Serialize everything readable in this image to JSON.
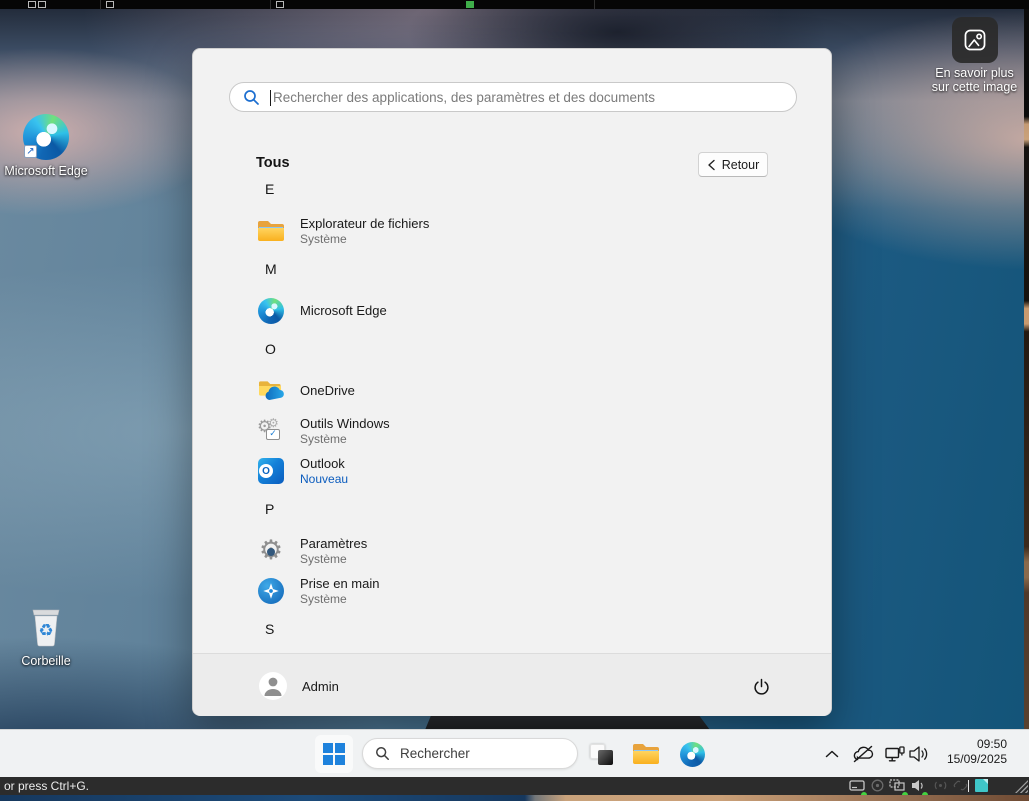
{
  "colors": {
    "accent": "#0067c0",
    "nouveau_link": "#0b5cbe",
    "menu_bg": "#f2f2f2",
    "taskbar_bg": "#f0f2f3"
  },
  "desktop": {
    "icons": [
      {
        "label": "Microsoft Edge"
      },
      {
        "label": "Corbeille"
      }
    ],
    "spotlight": {
      "line1": "En savoir plus",
      "line2": "sur cette image"
    }
  },
  "start_menu": {
    "search_placeholder": "Rechercher des applications, des paramètres et des documents",
    "section_title": "Tous",
    "back_button": "Retour",
    "letters": [
      "E",
      "M",
      "O",
      "P",
      "S"
    ],
    "apps": [
      {
        "name": "Explorateur de fichiers",
        "sub": "Système"
      },
      {
        "name": "Microsoft Edge"
      },
      {
        "name": "OneDrive"
      },
      {
        "name": "Outils Windows",
        "sub": "Système"
      },
      {
        "name": "Outlook",
        "sub": "Nouveau"
      },
      {
        "name": "Paramètres",
        "sub": "Système"
      },
      {
        "name": "Prise en main",
        "sub": "Système"
      }
    ],
    "footer": {
      "user": "Admin"
    }
  },
  "taskbar": {
    "search_placeholder": "Rechercher",
    "clock": {
      "time": "09:50",
      "date": "15/09/2025"
    }
  },
  "status_bar": {
    "text": "or press Ctrl+G."
  },
  "icons": {
    "menu_search": "magnifier-icon",
    "back": "chevron-left-icon",
    "power": "power-icon",
    "tray": [
      "chevron-up-icon",
      "onedrive-cloud-slash-icon",
      "network-icon",
      "volume-icon"
    ]
  }
}
